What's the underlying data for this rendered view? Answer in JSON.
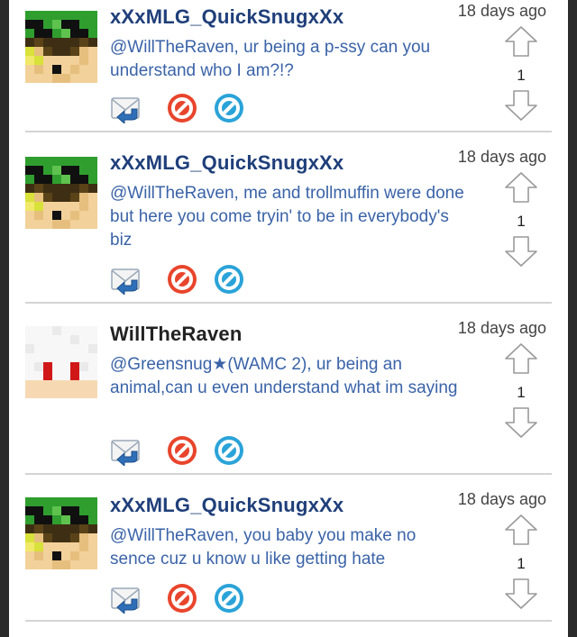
{
  "comments": [
    {
      "author": "xXxMLG_QuickSnugxXx",
      "time": "18 days ago",
      "body": "@WillTheRaven, ur being a p-ssy can you understand who I am?!?",
      "votes": "1",
      "author_color": "#1f3f7a",
      "avatar": "green"
    },
    {
      "author": "xXxMLG_QuickSnugxXx",
      "time": "18 days ago",
      "body": "@WillTheRaven, me and trollmuffin were done but here you come tryin' to be in everybody's biz",
      "votes": "1",
      "author_color": "#1f3f7a",
      "avatar": "green"
    },
    {
      "author": "WillTheRaven",
      "time": "18 days ago",
      "body": "@Greensnug★(WAMC 2), ur being an animal,can u even understand what im saying",
      "votes": "1",
      "author_color": "#222222",
      "avatar": "white"
    },
    {
      "author": "xXxMLG_QuickSnugxXx",
      "time": "18 days ago",
      "body": "@WillTheRaven, you baby you make no sence cuz u know u like getting hate",
      "votes": "1",
      "author_color": "#1f3f7a",
      "avatar": "green"
    }
  ],
  "icons": {
    "reply": "reply-mail-icon",
    "report": "report-prohibited-icon",
    "block": "block-icon",
    "upvote": "upvote-arrow-icon",
    "downvote": "downvote-arrow-icon"
  },
  "colors": {
    "link_text": "#3a63a8",
    "report_red": "#e8452c",
    "block_blue": "#2aa3d8"
  }
}
